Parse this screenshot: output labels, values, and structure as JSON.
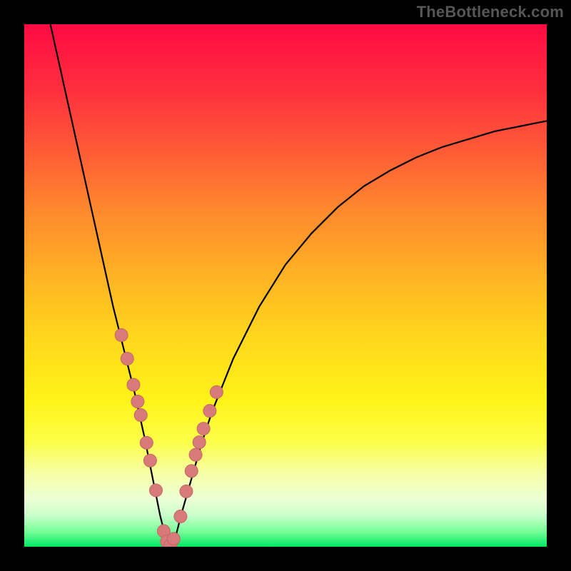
{
  "watermark": "TheBottleneck.com",
  "colors": {
    "curve_stroke": "#000000",
    "marker_fill": "#d87a7a",
    "marker_stroke": "#c46666",
    "background": "#000000"
  },
  "chart_data": {
    "type": "line",
    "title": "",
    "xlabel": "",
    "ylabel": "",
    "xlim": [
      0,
      100
    ],
    "ylim": [
      0,
      100
    ],
    "grid": false,
    "legend": false,
    "series": [
      {
        "name": "bottleneck-curve",
        "x": [
          5,
          7,
          9,
          11,
          13,
          15,
          17,
          19,
          21,
          23,
          24,
          25,
          26,
          27,
          28,
          29,
          30,
          32,
          34,
          36,
          40,
          45,
          50,
          55,
          60,
          65,
          70,
          75,
          80,
          85,
          90,
          95,
          100
        ],
        "y": [
          100,
          91,
          82,
          73,
          64,
          55,
          46,
          38,
          30,
          21,
          16,
          11,
          6,
          2,
          0,
          2,
          6,
          13,
          20,
          26,
          36,
          46,
          54,
          60,
          65,
          69,
          72,
          74.5,
          76.5,
          78,
          79.5,
          80.5,
          81.5
        ]
      }
    ],
    "markers": {
      "name": "highlight-points",
      "x": [
        18.6,
        19.7,
        20.9,
        21.7,
        22.3,
        23.4,
        24.1,
        25.2,
        26.7,
        27.3,
        28.0,
        28.6,
        29.9,
        31.0,
        32.0,
        32.8,
        33.5,
        34.3,
        35.5,
        36.8
      ],
      "y": [
        40.5,
        36.0,
        31.0,
        27.8,
        25.2,
        19.9,
        16.5,
        10.8,
        3.0,
        1.0,
        0.3,
        1.5,
        5.8,
        10.6,
        14.5,
        17.6,
        20.0,
        22.6,
        26.0,
        29.6
      ]
    }
  }
}
